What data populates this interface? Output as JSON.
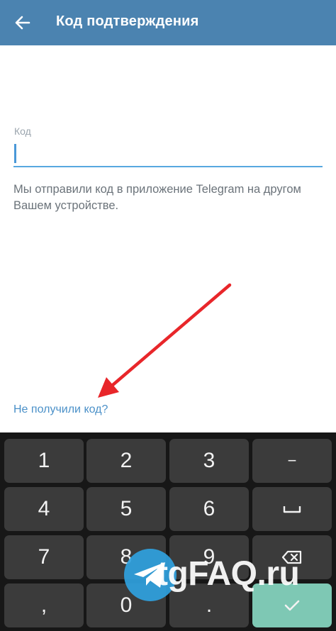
{
  "appbar": {
    "title": "Код подтверждения",
    "back_icon": "arrow-left-icon",
    "background": "#4b83b0"
  },
  "form": {
    "code_label": "Код",
    "code_value": "",
    "info_text": "Мы отправили код в приложение Telegram на другом Вашем устройстве.",
    "resend_link": "Не получили код?"
  },
  "keyboard": {
    "keys": [
      "1",
      "2",
      "3",
      "−",
      "4",
      "5",
      "6",
      "␣",
      "7",
      "8",
      "9",
      "⌫",
      ",",
      "0",
      ".",
      "✓"
    ],
    "done_color": "#7ec8b4"
  },
  "watermark": {
    "text": "tgFAQ.ru"
  },
  "colors": {
    "accent": "#58a8e0",
    "link": "#4a90c8",
    "annotation_arrow": "#e8262a"
  }
}
